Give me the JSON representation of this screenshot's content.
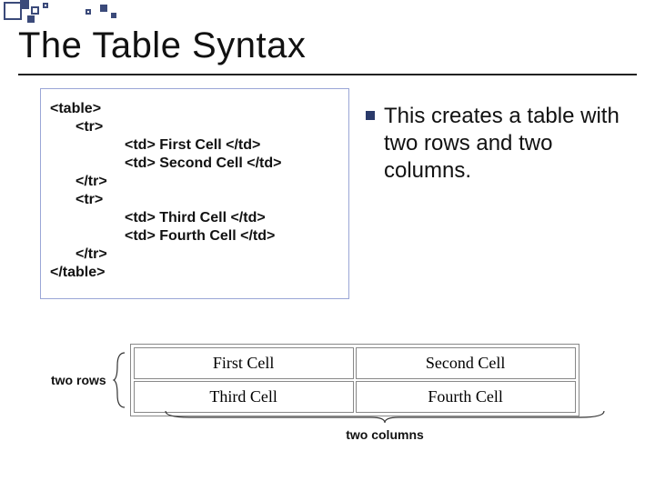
{
  "title": "The Table Syntax",
  "code": {
    "l0": "<table>",
    "l1": "<tr>",
    "l2": "<td> First Cell </td>",
    "l3": "<td> Second Cell </td>",
    "l4": "</tr>",
    "l5": "<tr>",
    "l6": "<td> Third Cell </td>",
    "l7": "<td> Fourth Cell </td>",
    "l8": "</tr>",
    "l9": "</table>"
  },
  "bullet": "This creates a table with two rows and two columns.",
  "demo": {
    "rows_label": "two rows",
    "cols_label": "two columns",
    "cells": {
      "r0c0": "First Cell",
      "r0c1": "Second Cell",
      "r1c0": "Third Cell",
      "r1c1": "Fourth Cell"
    }
  }
}
